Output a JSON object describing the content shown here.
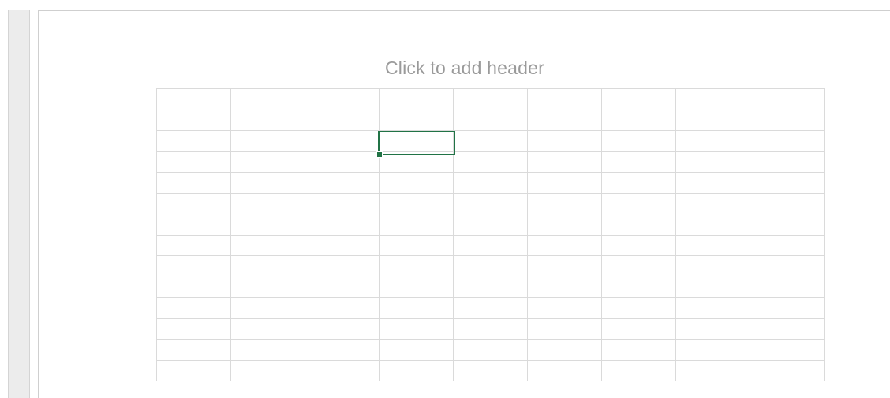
{
  "page": {
    "header_placeholder": "Click to add header"
  },
  "grid": {
    "columns": 9,
    "rows": 14,
    "selected": {
      "row": 3,
      "col": 4
    }
  },
  "colors": {
    "selection": "#217346",
    "gridline": "#dadada",
    "header_text": "#9a9a9a"
  }
}
